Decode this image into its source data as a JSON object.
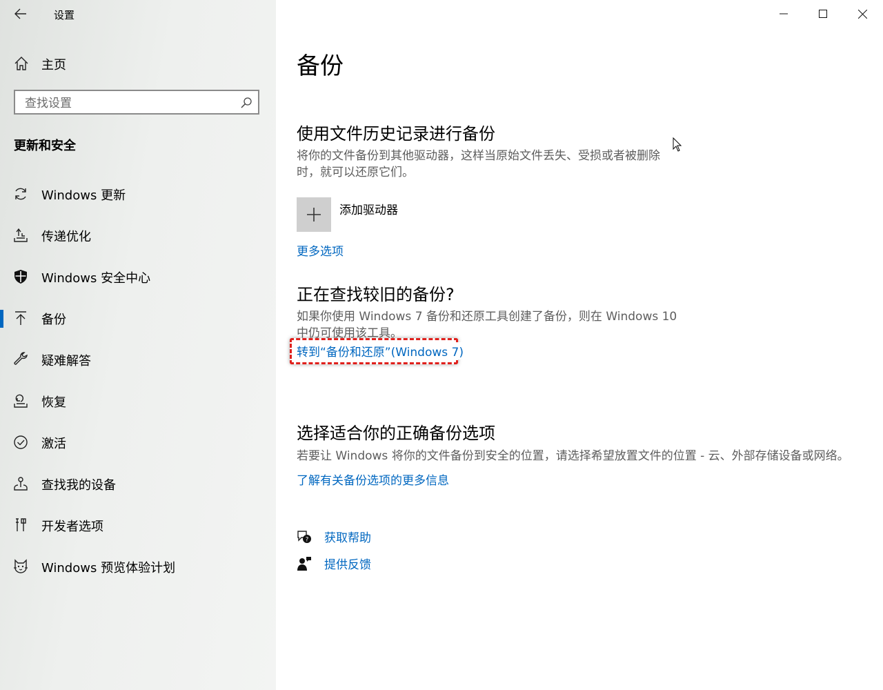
{
  "window": {
    "title": "设置",
    "controls": [
      "minimize",
      "maximize",
      "close"
    ]
  },
  "sidebar": {
    "home_label": "主页",
    "search_placeholder": "查找设置",
    "section_title": "更新和安全",
    "items": [
      {
        "label": "Windows 更新",
        "icon": "sync-icon"
      },
      {
        "label": "传递优化",
        "icon": "delivery-optimization-icon"
      },
      {
        "label": "Windows 安全中心",
        "icon": "shield-icon"
      },
      {
        "label": "备份",
        "icon": "backup-arrow-icon",
        "selected": true
      },
      {
        "label": "疑难解答",
        "icon": "wrench-icon"
      },
      {
        "label": "恢复",
        "icon": "recovery-icon"
      },
      {
        "label": "激活",
        "icon": "check-circle-icon"
      },
      {
        "label": "查找我的设备",
        "icon": "find-device-icon"
      },
      {
        "label": "开发者选项",
        "icon": "developer-tools-icon"
      },
      {
        "label": "Windows 预览体验计划",
        "icon": "insider-cat-icon"
      }
    ]
  },
  "main": {
    "page_title": "备份",
    "file_history": {
      "heading": "使用文件历史记录进行备份",
      "description_line1": "将你的文件备份到其他驱动器，这样当原始文件丢失、受损或者被删除",
      "description_line2": "时，就可以还原它们。",
      "add_drive_label": "添加驱动器",
      "more_options_link": "更多选项"
    },
    "older_backup": {
      "heading": "正在查找较旧的备份?",
      "description_line1": "如果你使用 Windows 7 备份和还原工具创建了备份，则在 Windows 10",
      "description_line2": "中仍可使用该工具。",
      "link": "转到“备份和还原”(Windows 7)"
    },
    "choose_option": {
      "heading": "选择适合你的正确备份选项",
      "description": "若要让 Windows 将你的文件备份到安全的位置，请选择希望放置文件的位置 - 云、外部存储设备或网络。",
      "link": "了解有关备份选项的更多信息"
    },
    "help": {
      "get_help": "获取帮助",
      "feedback": "提供反馈"
    }
  },
  "colors": {
    "accent": "#0067c0",
    "highlight": "#e0201c"
  }
}
